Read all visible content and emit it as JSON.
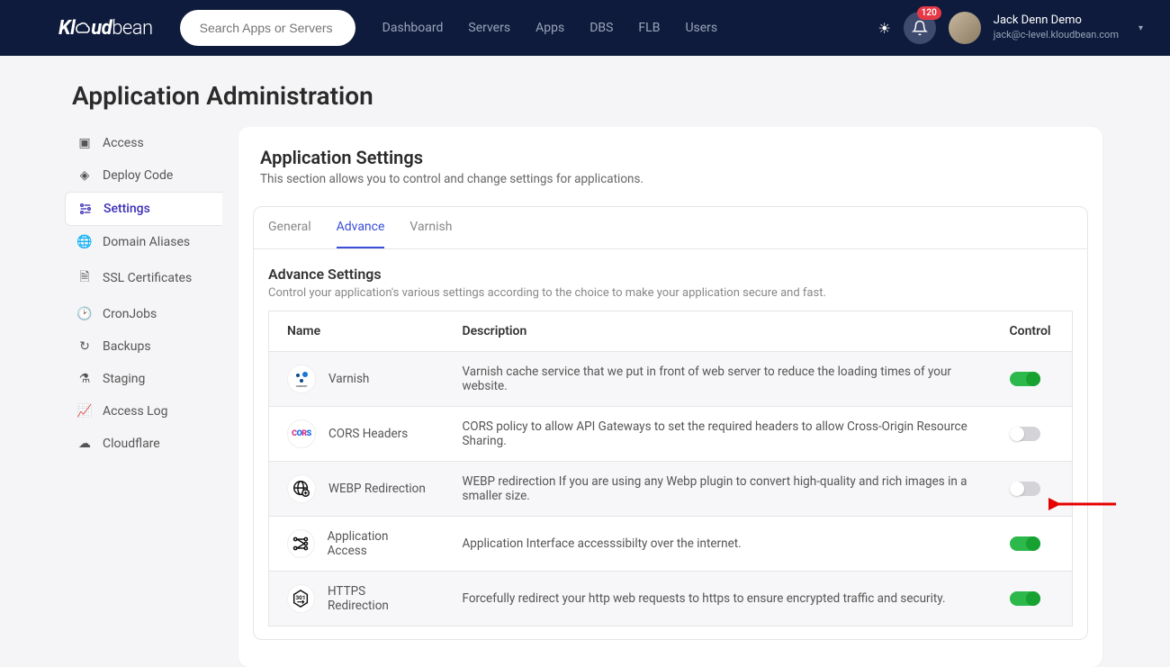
{
  "brand": "Kloudbean",
  "search": {
    "placeholder": "Search Apps or Servers"
  },
  "nav": [
    "Dashboard",
    "Servers",
    "Apps",
    "DBS",
    "FLB",
    "Users"
  ],
  "notifications": {
    "count": "120"
  },
  "user": {
    "name": "Jack Denn Demo",
    "email": "jack@c-level.kloudbean.com"
  },
  "page_title": "Application Administration",
  "sidebar": {
    "items": [
      {
        "label": "Access"
      },
      {
        "label": "Deploy Code"
      },
      {
        "label": "Settings"
      },
      {
        "label": "Domain Aliases"
      },
      {
        "label": "SSL Certificates"
      },
      {
        "label": "CronJobs"
      },
      {
        "label": "Backups"
      },
      {
        "label": "Staging"
      },
      {
        "label": "Access Log"
      },
      {
        "label": "Cloudflare"
      }
    ]
  },
  "card": {
    "title": "Application Settings",
    "subtitle": "This section allows you to control and change settings for applications."
  },
  "tabs": [
    {
      "label": "General"
    },
    {
      "label": "Advance"
    },
    {
      "label": "Varnish"
    }
  ],
  "section": {
    "title": "Advance Settings",
    "desc": "Control your application's various settings according to the choice to make your application secure and fast."
  },
  "table": {
    "headers": {
      "name": "Name",
      "description": "Description",
      "control": "Control"
    },
    "rows": [
      {
        "name": "Varnish",
        "desc": "Varnish cache service that we put in front of web server to reduce the loading times of your website.",
        "on": true
      },
      {
        "name": "CORS Headers",
        "desc": "CORS policy to allow API Gateways to set the required headers to allow Cross-Origin Resource Sharing.",
        "on": false
      },
      {
        "name": "WEBP Redirection",
        "desc": "WEBP redirection If you are using any Webp plugin to convert high-quality and rich images in a smaller size.",
        "on": false
      },
      {
        "name": "Application Access",
        "desc": "Application Interface accesssibilty over the internet.",
        "on": true
      },
      {
        "name": "HTTPS Redirection",
        "desc": "Forcefully redirect your http web requests to https to ensure encrypted traffic and security.",
        "on": true
      }
    ]
  }
}
